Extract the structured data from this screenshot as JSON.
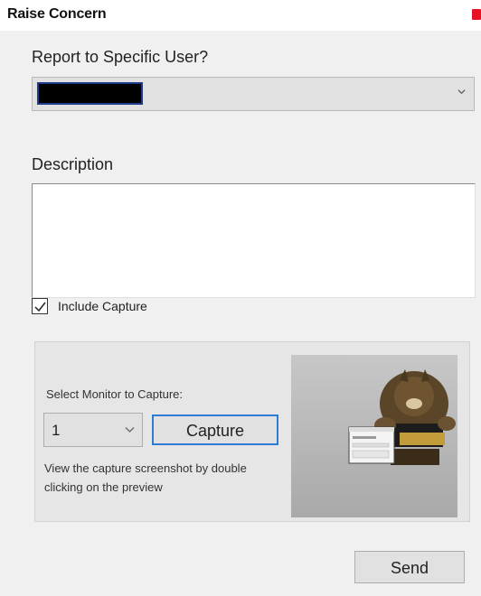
{
  "window": {
    "title": "Raise Concern",
    "close_icon": "close-icon",
    "accent_color": "#2d7bd6",
    "close_color": "#e81123"
  },
  "report": {
    "label": "Report to Specific User?",
    "selected_value_redacted": true,
    "chevron_icon": "chevron-down-icon"
  },
  "description": {
    "label": "Description",
    "value": ""
  },
  "include_capture": {
    "label": "Include Capture",
    "checked": true,
    "check_icon": "checkmark-icon"
  },
  "capture": {
    "monitor_label": "Select Monitor to Capture:",
    "monitor_value": "1",
    "capture_button": "Capture",
    "help_text": "View the capture screenshot by double clicking on the preview",
    "preview_image": "screenshot-preview-thumbnail"
  },
  "footer": {
    "send_button": "Send"
  }
}
